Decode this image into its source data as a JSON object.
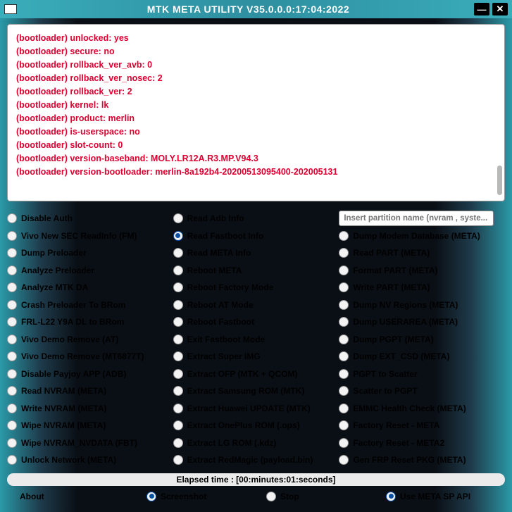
{
  "title": "MTK META UTILITY V35.0.0.0:17:04:2022",
  "log_lines": [
    "(bootloader) unlocked: yes",
    "(bootloader) secure: no",
    "(bootloader) rollback_ver_avb: 0",
    "(bootloader) rollback_ver_nosec: 2",
    "(bootloader) rollback_ver: 2",
    "(bootloader) kernel: lk",
    "(bootloader) product: merlin",
    "(bootloader) is-userspace: no",
    "(bootloader) slot-count: 0",
    "(bootloader) version-baseband: MOLY.LR12A.R3.MP.V94.3",
    "(bootloader) version-bootloader: merlin-8a192b4-20200513095400-202005131"
  ],
  "input": {
    "placeholder": "Insert partition name (nvram , syste..."
  },
  "col1": [
    "Disable Auth",
    "Vivo New SEC ReadInfo (FM)",
    "Dump Preloader",
    "Analyze Preloader",
    "Analyze MTK DA",
    "Crash Preloader To BRom",
    "FRL-L22 Y9A DL to BRom",
    "Vivo Demo Remove (AT)",
    "Vivo Demo Remove (MT6877T)",
    "Disable Payjoy APP (ADB)",
    "Read NVRAM (META)",
    "Write NVRAM (META)",
    "Wipe NVRAM (META)",
    "Wipe NVRAM_NVDATA (FBT)",
    "Unlock Network (META)"
  ],
  "col2": [
    "Read Adb Info",
    "Read Fastboot Info",
    "Read META Info",
    "Reboot META",
    "Reboot Factory Mode",
    "Reboot AT Mode",
    "Reboot Fastboot",
    "Exit Fastboot Mode",
    "Extract Super IMG",
    "Extract OFP (MTK + QCOM)",
    "Extract Samsung ROM (MTK)",
    "Extract Huawei UPDATE (MTK)",
    "Extract OnePlus ROM (.ops)",
    "Extract LG ROM (.kdz)",
    "Extract RedMagic (payload.bin)"
  ],
  "col2_selected": 1,
  "col3": [
    "Dump Modem Database (META)",
    "Read PART (META)",
    "Format PART (META)",
    "Write PART (META)",
    "Dump NV Regions (META)",
    "Dump USERAREA (META)",
    "Dump PGPT (META)",
    "Dump  EXT_CSD (META)",
    "PGPT to Scatter",
    "Scatter to PGPT",
    "EMMC Health Check (META)",
    "Factory Reset - META",
    "Factory Reset - META2",
    "Gen FRP Reset PKG (META)"
  ],
  "status": "Elapsed time : [00:minutes:01:seconds]",
  "bottom": {
    "about": "About",
    "screenshot": "Screenshot",
    "stop": "Stop",
    "use_meta": "Use META SP API"
  }
}
